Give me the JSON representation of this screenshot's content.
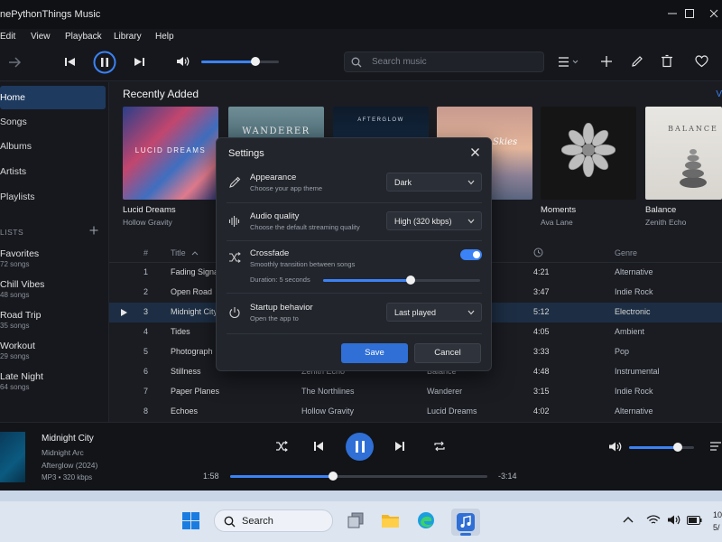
{
  "window": {
    "title": "nePythonThings Music"
  },
  "menu": [
    "Edit",
    "View",
    "Playback",
    "Library",
    "Help"
  ],
  "toolbar": {
    "search_placeholder": "Search music",
    "volume": 0.7
  },
  "sidebar": {
    "nav": [
      "Home",
      "Songs",
      "Albums",
      "Artists",
      "Playlists"
    ],
    "section_label": "LISTS",
    "playlists": [
      {
        "name": "Favorites",
        "count": "72 songs"
      },
      {
        "name": "Chill Vibes",
        "count": "48 songs"
      },
      {
        "name": "Road Trip",
        "count": "35 songs"
      },
      {
        "name": "Workout",
        "count": "29 songs"
      },
      {
        "name": "Late Night",
        "count": "64 songs"
      }
    ]
  },
  "main": {
    "title": "Recently Added",
    "view_all": "V",
    "albums": [
      {
        "name": "Lucid Dreams",
        "artist": "Hollow Gravity",
        "art_text": "LUCID DREAMS"
      },
      {
        "name": "",
        "artist": "",
        "art_text": "WANDERER"
      },
      {
        "name": "",
        "artist": "",
        "art_text": "AFTERGLOW"
      },
      {
        "name": "",
        "artist": "",
        "art_text": "Skies"
      },
      {
        "name": "Moments",
        "artist": "Ava Lane",
        "art_text": ""
      },
      {
        "name": "Balance",
        "artist": "Zenith Echo",
        "art_text": "BALANCE"
      }
    ],
    "columns": {
      "num": "#",
      "title": "Title",
      "genre": "Genre"
    },
    "rows": [
      {
        "num": "1",
        "title": "Fading Signal",
        "artist": "",
        "album": "",
        "time": "4:21",
        "genre": "Alternative"
      },
      {
        "num": "2",
        "title": "Open Road",
        "artist": "",
        "album": "",
        "time": "3:47",
        "genre": "Indie Rock"
      },
      {
        "num": "3",
        "title": "Midnight City",
        "artist": "",
        "album": "",
        "time": "5:12",
        "genre": "Electronic"
      },
      {
        "num": "4",
        "title": "Tides",
        "artist": "",
        "album": "",
        "time": "4:05",
        "genre": "Ambient"
      },
      {
        "num": "5",
        "title": "Photograph",
        "artist": "",
        "album": "",
        "time": "3:33",
        "genre": "Pop"
      },
      {
        "num": "6",
        "title": "Stillness",
        "artist": "Zenith Echo",
        "album": "Balance",
        "time": "4:48",
        "genre": "Instrumental"
      },
      {
        "num": "7",
        "title": "Paper Planes",
        "artist": "The Northlines",
        "album": "Wanderer",
        "time": "3:15",
        "genre": "Indie Rock"
      },
      {
        "num": "8",
        "title": "Echoes",
        "artist": "Hollow Gravity",
        "album": "Lucid Dreams",
        "time": "4:02",
        "genre": "Alternative"
      }
    ]
  },
  "player": {
    "title": "Midnight City",
    "artist": "Midnight Arc",
    "album": "Afterglow (2024)",
    "format": "MP3 • 320 kbps",
    "elapsed": "1:58",
    "remaining": "-3:14",
    "progress": 0.4,
    "volume": 0.75
  },
  "taskbar": {
    "search_label": "Search",
    "time": "10",
    "date": "5/"
  },
  "dialog": {
    "title": "Settings",
    "appearance": {
      "label": "Appearance",
      "desc": "Choose your app theme",
      "value": "Dark"
    },
    "audio": {
      "label": "Audio quality",
      "desc": "Choose the default streaming quality",
      "value": "High (320 kbps)"
    },
    "crossfade": {
      "label": "Crossfade",
      "desc": "Smoothly transition between songs",
      "duration_label": "Duration: 5 seconds",
      "duration_fraction": 0.56,
      "enabled": true
    },
    "startup": {
      "label": "Startup behavior",
      "desc": "Open the app to",
      "value": "Last played"
    },
    "save": "Save",
    "cancel": "Cancel"
  },
  "colors": {
    "accent": "#2f6fd6",
    "accent_light": "#3b82f6",
    "bg": "#1a1c22",
    "sidebar_active": "#1e3a5f"
  }
}
